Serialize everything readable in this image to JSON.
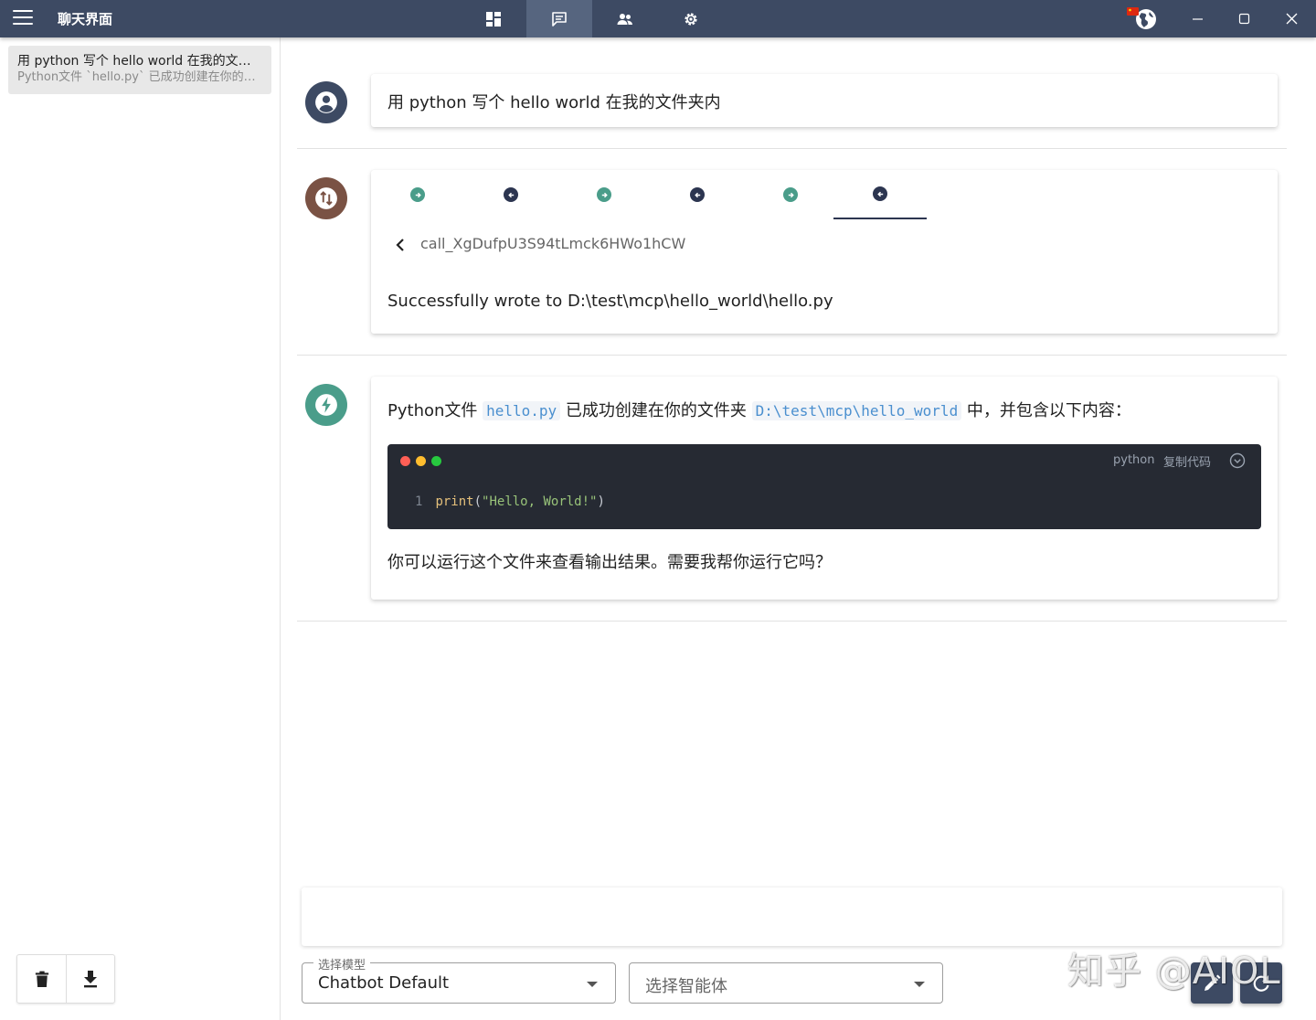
{
  "titlebar": {
    "title": "聊天界面",
    "nav_tabs": [
      {
        "icon": "dashboard-icon",
        "active": false
      },
      {
        "icon": "chat-icon",
        "active": true
      },
      {
        "icon": "people-icon",
        "active": false
      },
      {
        "icon": "settings-icon",
        "active": false
      }
    ],
    "window_controls": [
      "minimize-icon",
      "maximize-icon",
      "close-icon"
    ]
  },
  "sidebar": {
    "conversations": [
      {
        "title": "用 python 写个 hello world 在我的文件夹内",
        "subtitle": "Python文件 `hello.py` 已成功创建在你的文件夹"
      }
    ],
    "actions": [
      "delete-icon",
      "download-icon"
    ]
  },
  "messages": {
    "user": {
      "text": "用 python 写个 hello world 在我的文件夹内"
    },
    "tool": {
      "call_id": "call_XgDufpU3S94tLmck6HWo1hCW",
      "result": "Successfully wrote to D:\\test\\mcp\\hello_world\\hello.py",
      "steps": [
        "out",
        "in",
        "out",
        "in",
        "out",
        "in"
      ]
    },
    "assistant": {
      "intro_1": "Python文件 ",
      "file_name": "hello.py",
      "intro_2": " 已成功创建在你的文件夹 ",
      "folder": "D:\\test\\mcp\\hello_world",
      "intro_3": " 中，并包含以下内容：",
      "code": {
        "language": "python",
        "copy_label": "复制代码",
        "line_number": "1",
        "fn": "print",
        "open_paren": "(",
        "string": "\"Hello, World!\"",
        "close_paren": ")"
      },
      "outro": "你可以运行这个文件来查看输出结果。需要我帮你运行它吗？"
    }
  },
  "input": {
    "placeholder": ""
  },
  "model_select": {
    "label": "选择模型",
    "value": "Chatbot Default"
  },
  "agent_select": {
    "placeholder": "选择智能体"
  },
  "watermark": "知乎 @AIOL",
  "colors": {
    "titlebar": "#3d4a63",
    "accent_teal": "#4a9d8a",
    "tool_brown": "#7a5244",
    "user_navy": "#3d4a63",
    "code_bg": "#262a33"
  }
}
